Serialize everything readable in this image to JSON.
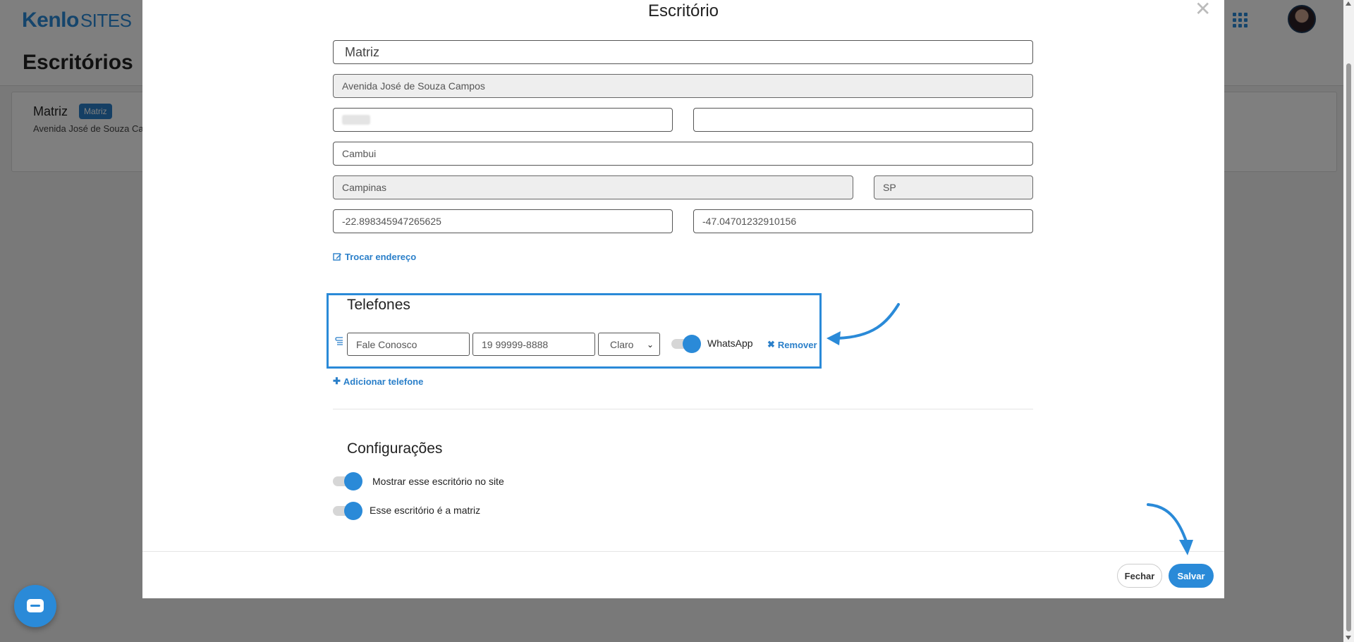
{
  "app": {
    "logo_primary": "Kenlo",
    "logo_secondary": "SITES",
    "page_title": "Escritórios",
    "accent_color": "#2a8ad8"
  },
  "office_card": {
    "name": "Matriz",
    "badge": "Matriz",
    "address": "Avenida José de Souza Ca"
  },
  "modal": {
    "title": "Escritório",
    "fields": {
      "name": "Matriz",
      "street": "Avenida José de Souza Campos",
      "number": "",
      "complement": "",
      "neighborhood": "Cambui",
      "city": "Campinas",
      "state": "SP",
      "latitude": "-22.898345947265625",
      "longitude": "-47.04701232910156"
    },
    "change_address_link": "Trocar endereço",
    "phones": {
      "title": "Telefones",
      "items": [
        {
          "label": "Fale Conosco",
          "number": "19 99999-8888",
          "carrier": "Claro",
          "whatsapp_label": "WhatsApp",
          "whatsapp_enabled": true,
          "remove_label": "Remover"
        }
      ],
      "add_label": "Adicionar telefone"
    },
    "settings": {
      "title": "Configurações",
      "show_on_site_label": "Mostrar esse escritório no site",
      "show_on_site": true,
      "is_main_label": "Esse escritório é a matriz",
      "is_main": true
    },
    "buttons": {
      "close": "Fechar",
      "save": "Salvar"
    }
  }
}
